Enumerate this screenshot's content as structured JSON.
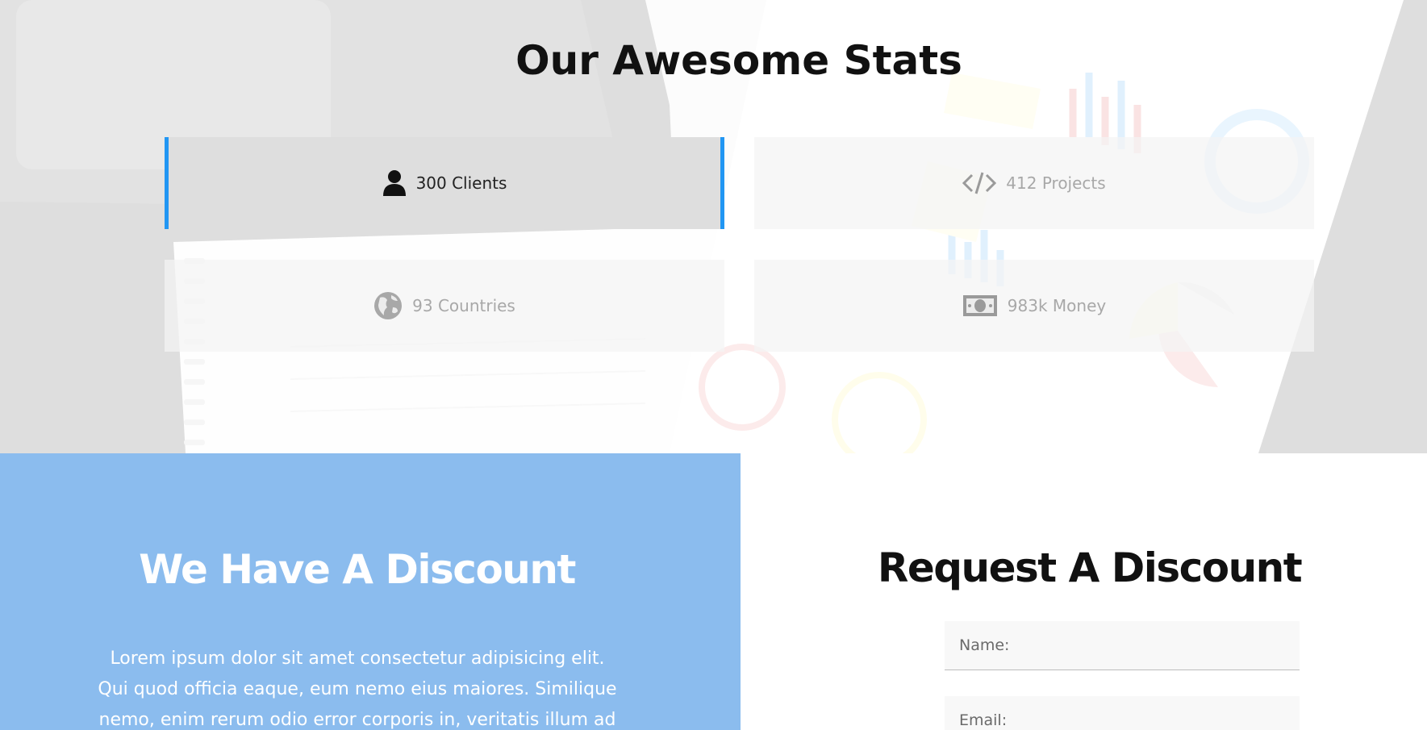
{
  "stats": {
    "title": "Our Awesome Stats",
    "items": [
      {
        "label": "300 Clients",
        "icon": "user-icon",
        "active": true
      },
      {
        "label": "412 Projects",
        "icon": "code-icon",
        "active": false
      },
      {
        "label": "93 Countries",
        "icon": "globe-icon",
        "active": false
      },
      {
        "label": "983k Money",
        "icon": "money-icon",
        "active": false
      }
    ]
  },
  "discount": {
    "title": "We Have A Discount",
    "text": "Lorem ipsum dolor sit amet consectetur adipisicing elit. Qui quod officia eaque, eum nemo eius maiores. Similique nemo, enim rerum odio error corporis in, veritatis illum ad"
  },
  "request": {
    "title": "Request A Discount",
    "name_placeholder": "Name:",
    "email_placeholder": "Email:"
  },
  "colors": {
    "accent": "#2196f3",
    "panel_blue": "#8bbcee",
    "active_box": "#dedede"
  }
}
